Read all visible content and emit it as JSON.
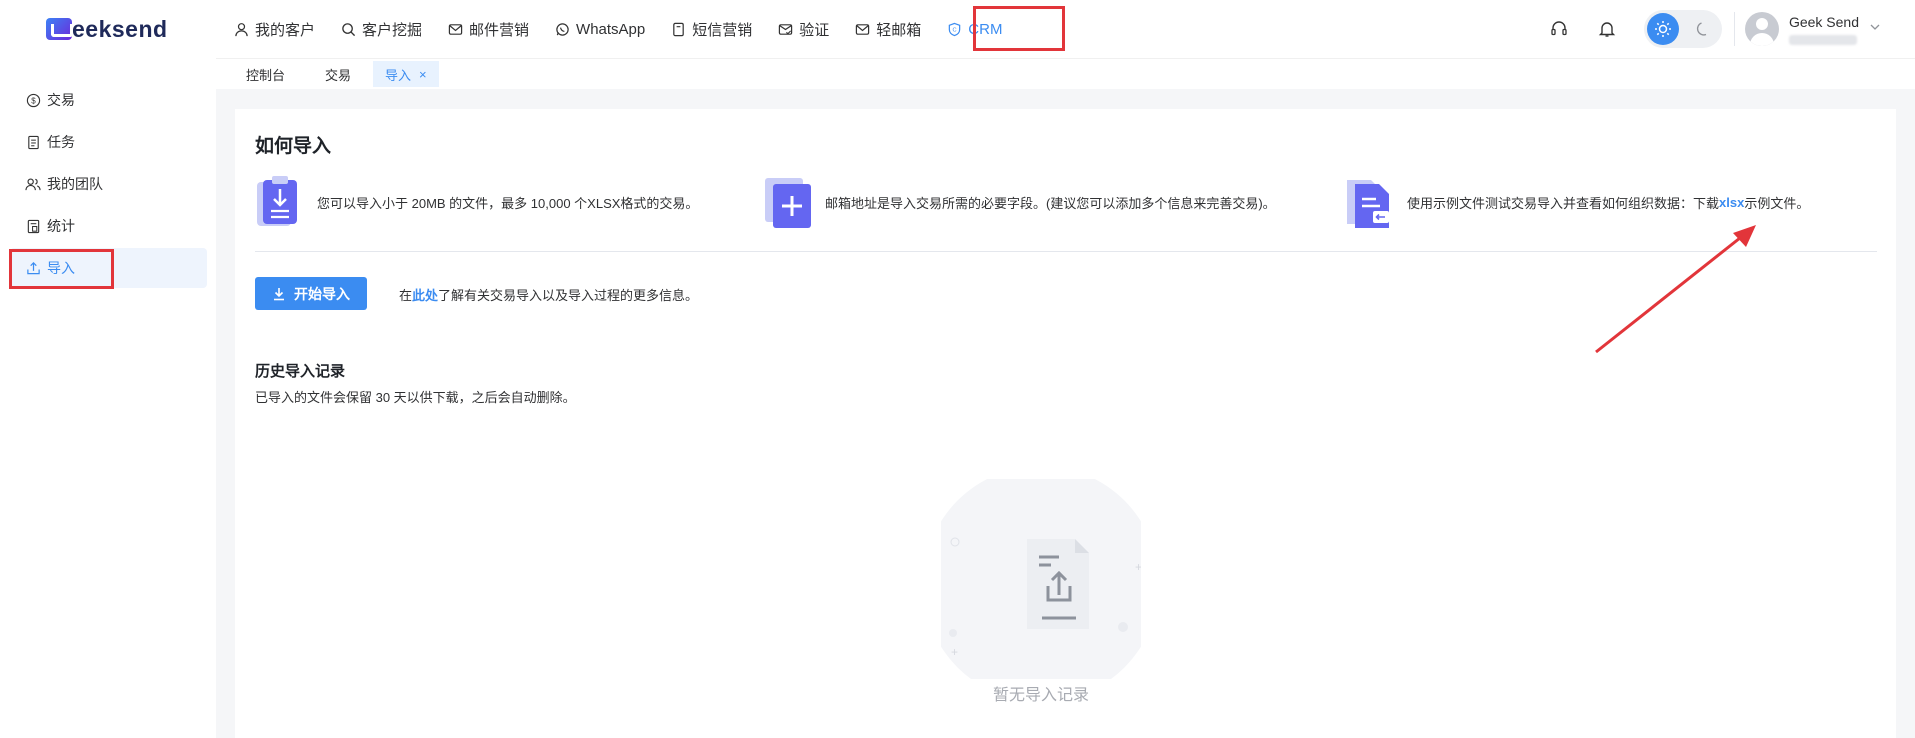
{
  "brand": {
    "logo_text": "eeksend"
  },
  "nav": {
    "items": [
      {
        "label": "我的客户",
        "icon": "user-icon"
      },
      {
        "label": "客户挖掘",
        "icon": "search-icon"
      },
      {
        "label": "邮件营销",
        "icon": "mail-icon"
      },
      {
        "label": "WhatsApp",
        "icon": "whatsapp-icon"
      },
      {
        "label": "短信营销",
        "icon": "sms-icon"
      },
      {
        "label": "验证",
        "icon": "verify-mail-icon"
      },
      {
        "label": "轻邮箱",
        "icon": "light-mail-icon"
      },
      {
        "label": "CRM",
        "icon": "crm-icon"
      }
    ],
    "active": "CRM"
  },
  "header_tools": {
    "user_name": "Geek Send",
    "accent_color": "#3b8cf1"
  },
  "tabs": [
    {
      "label": "控制台"
    },
    {
      "label": "交易"
    },
    {
      "label": "导入",
      "close": "×"
    }
  ],
  "sidebar": {
    "items": [
      {
        "label": "交易",
        "icon": "dollar-icon"
      },
      {
        "label": "任务",
        "icon": "task-icon"
      },
      {
        "label": "我的团队",
        "icon": "team-icon"
      },
      {
        "label": "统计",
        "icon": "stats-icon"
      },
      {
        "label": "导入",
        "icon": "upload-icon"
      }
    ],
    "active": "导入"
  },
  "main": {
    "title": "如何导入",
    "info": [
      {
        "text": "您可以导入小于 20MB 的文件，最多 10,000 个XLSX格式的交易。"
      },
      {
        "text": "邮箱地址是导入交易所需的必要字段。(建议您可以添加多个信息来完善交易)。"
      },
      {
        "prefix": "使用示例文件测试交易导入并查看如何组织数据：下载 ",
        "link": "xlsx",
        "suffix": "示例文件。"
      }
    ],
    "start_button": "开始导入",
    "more_prefix": "在",
    "more_link": "此处",
    "more_suffix": "了解有关交易导入以及导入过程的更多信息。",
    "history_title": "历史导入记录",
    "history_desc": "已导入的文件会保留 30 天以供下载，之后会自动删除。",
    "empty_text": "暂无导入记录"
  }
}
